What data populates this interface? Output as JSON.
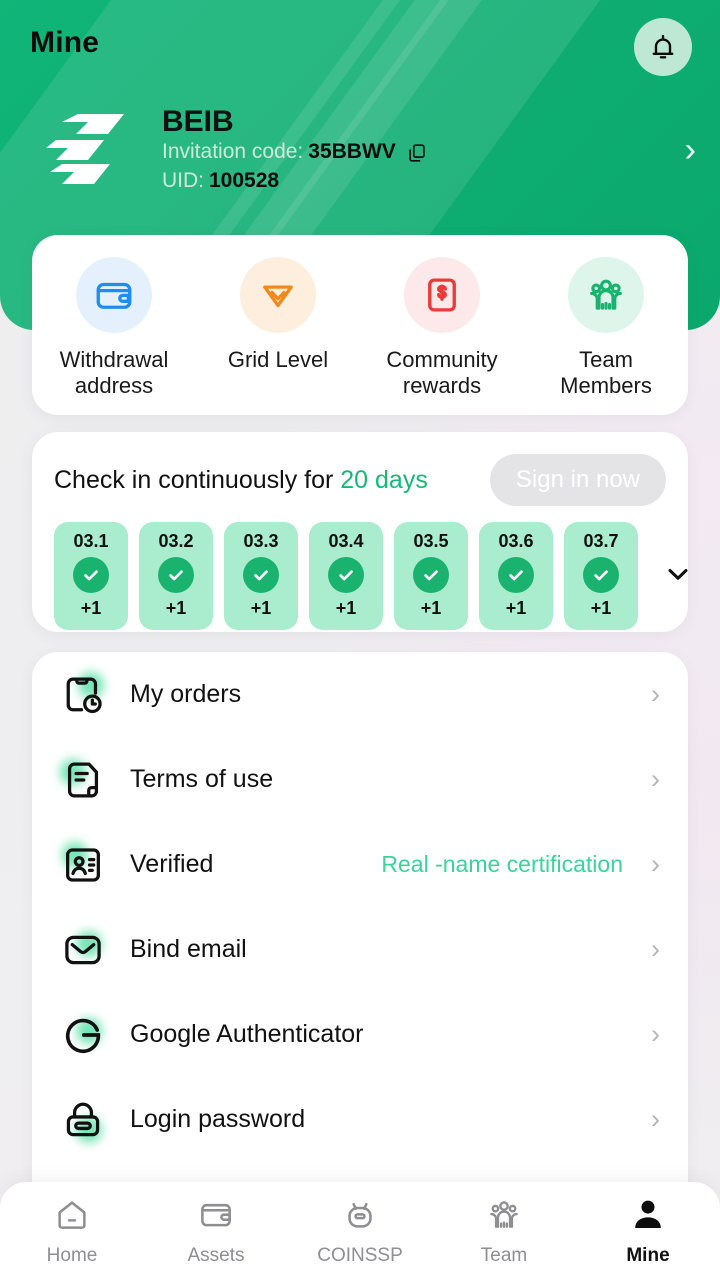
{
  "header": {
    "title": "Mine",
    "bell_icon": "bell-icon",
    "profile": {
      "logo_icon": "brand-logo-icon",
      "name": "BEIB",
      "invitation_label": "Invitation code:",
      "invitation_code": "35BBWV",
      "copy_icon": "copy-icon",
      "uid_label": "UID:",
      "uid_value": "100528",
      "arrow": "›"
    },
    "accent_green": "#11b578"
  },
  "quick_actions": [
    {
      "label": "Withdrawal address",
      "icon": "wallet-icon",
      "color": "#1f8df0",
      "bg": "#e4f1fd"
    },
    {
      "label": "Grid Level",
      "icon": "diamond-icon",
      "color": "#f08a1f",
      "bg": "#fdeede"
    },
    {
      "label": "Community rewards",
      "icon": "dollar-book-icon",
      "color": "#ea3b3b",
      "bg": "#fde9e9"
    },
    {
      "label": "Team Members",
      "icon": "team-group-icon",
      "color": "#19b26e",
      "bg": "#ddf5ea"
    }
  ],
  "checkin": {
    "title_prefix": "Check in continuously for",
    "days_text": "20 days",
    "sign_in_label": "Sign in now",
    "sign_in_disabled": true,
    "expand_icon": "chevron-down-icon",
    "cell_bg": "#a9ecce",
    "check_color": "#19b26e",
    "days": [
      {
        "date": "03.1",
        "reward": "+1",
        "checked": true
      },
      {
        "date": "03.2",
        "reward": "+1",
        "checked": true
      },
      {
        "date": "03.3",
        "reward": "+1",
        "checked": true
      },
      {
        "date": "03.4",
        "reward": "+1",
        "checked": true
      },
      {
        "date": "03.5",
        "reward": "+1",
        "checked": true
      },
      {
        "date": "03.6",
        "reward": "+1",
        "checked": true
      },
      {
        "date": "03.7",
        "reward": "+1",
        "checked": true
      }
    ]
  },
  "menu": [
    {
      "label": "My orders",
      "icon": "order-clock-icon",
      "value": ""
    },
    {
      "label": "Terms of use",
      "icon": "document-icon",
      "value": ""
    },
    {
      "label": "Verified",
      "icon": "id-card-icon",
      "value": "Real -name certification"
    },
    {
      "label": "Bind email",
      "icon": "envelope-icon",
      "value": ""
    },
    {
      "label": "Google Authenticator",
      "icon": "google-g-icon",
      "value": ""
    },
    {
      "label": "Login password",
      "icon": "lock-icon",
      "value": ""
    }
  ],
  "menu_arrow": "›",
  "bottom_nav": [
    {
      "label": "Home",
      "icon": "home-icon",
      "active": false
    },
    {
      "label": "Assets",
      "icon": "wallet-icon",
      "active": false
    },
    {
      "label": "COINSSP",
      "icon": "robot-icon",
      "active": false
    },
    {
      "label": "Team",
      "icon": "team-icon",
      "active": false
    },
    {
      "label": "Mine",
      "icon": "person-icon",
      "active": true
    }
  ]
}
